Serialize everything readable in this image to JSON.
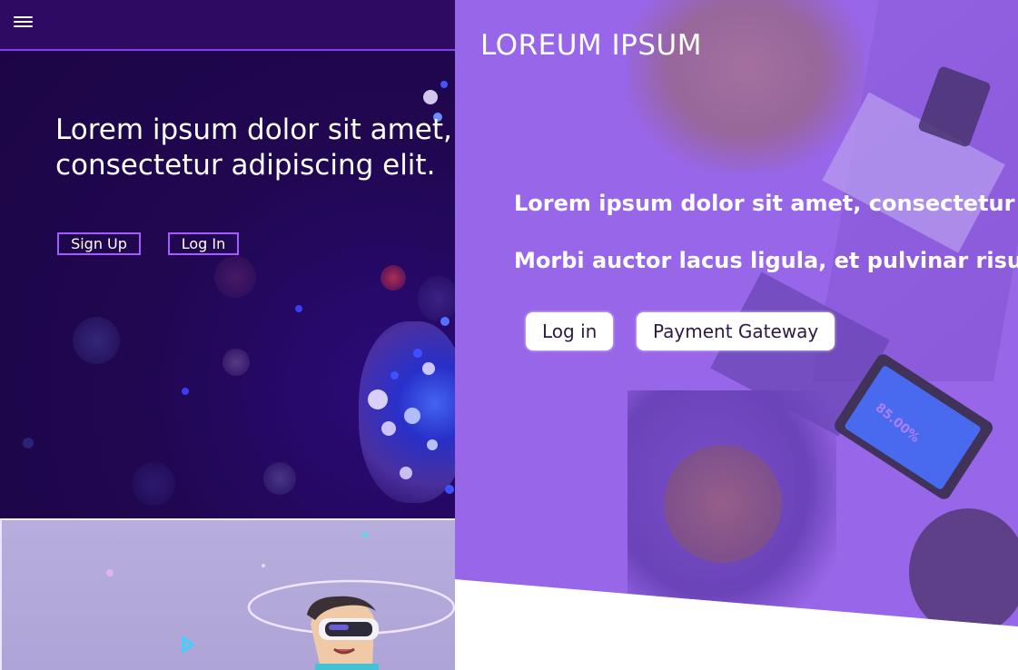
{
  "left_panel": {
    "menu_icon": "hamburger-menu-icon",
    "heading_line1": "Lorem ipsum dolor sit amet,",
    "heading_line2": "consectetur adipiscing elit.",
    "signup_label": "Sign Up",
    "login_label": "Log In",
    "colors": {
      "background": "#1c0545",
      "topbar": "#2f0a62",
      "accent": "#a45cff"
    }
  },
  "left_bottom": {
    "illustration": "vr-headset-character-illustration"
  },
  "right_panel": {
    "logo": "LOREUM IPSUM",
    "line1": "Lorem ipsum dolor sit amet, consectetur adipiscing elit.",
    "line2": "Morbi auctor lacus ligula, et pulvinar risus imperdiet.",
    "login_label": "Log in",
    "payment_label": "Payment Gateway",
    "tablet_readout": "85.00%",
    "colors": {
      "overlay": "#9a6ae6",
      "button_bg": "#ffffff"
    }
  }
}
